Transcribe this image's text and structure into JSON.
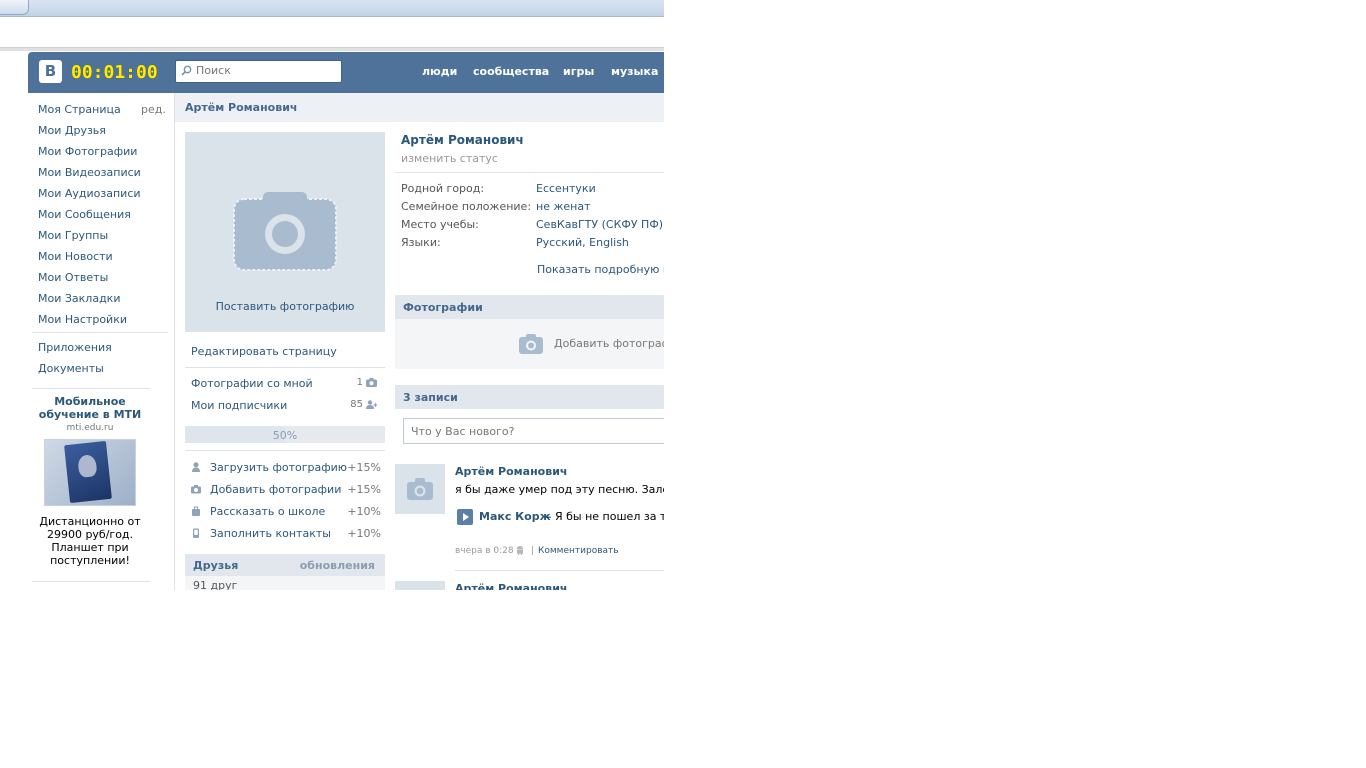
{
  "header": {
    "logo": "В",
    "timer": "00:01:00",
    "search_placeholder": "Поиск",
    "nav": [
      "люди",
      "сообщества",
      "игры",
      "музыка"
    ]
  },
  "sidebar": {
    "items": [
      "Моя Страница",
      "Мои Друзья",
      "Мои Фотографии",
      "Мои Видеозаписи",
      "Мои Аудиозаписи",
      "Мои Сообщения",
      "Мои Группы",
      "Мои Новости",
      "Мои Ответы",
      "Мои Закладки",
      "Мои Настройки"
    ],
    "edit_label": "ред.",
    "extra_items": [
      "Приложения",
      "Документы"
    ],
    "ad": {
      "title": "Мобильное обучение в МТИ",
      "url": "mti.edu.ru",
      "text": "Дистанционно от 29900 руб/год. Планшет при поступлении!"
    }
  },
  "page": {
    "title": "Артём Романович",
    "avatar_label": "Поставить фотографию",
    "edit_page": "Редактировать страницу",
    "counters": [
      {
        "label": "Фотографии со мной",
        "count": "1",
        "icon": "camera-icon"
      },
      {
        "label": "Мои подписчики",
        "count": "85",
        "icon": "followers-icon"
      }
    ],
    "progress": {
      "value": 50,
      "label": "50%"
    },
    "tasks": [
      {
        "label": "Загрузить фотографию",
        "value": "+15%",
        "icon": "user-icon"
      },
      {
        "label": "Добавить фотографии",
        "value": "+15%",
        "icon": "camera-icon"
      },
      {
        "label": "Рассказать о школе",
        "value": "+10%",
        "icon": "briefcase-icon"
      },
      {
        "label": "Заполнить контакты",
        "value": "+10%",
        "icon": "phone-icon"
      }
    ],
    "friends": {
      "title": "Друзья",
      "updates": "обновления",
      "count": "91 друг"
    }
  },
  "profile": {
    "name": "Артём Романович",
    "status": "изменить статус",
    "info": [
      {
        "key": "Родной город:",
        "value": "Ессентуки"
      },
      {
        "key": "Семейное положение:",
        "value": "не женат"
      },
      {
        "key": "Место учебы:",
        "value": "СевКавГТУ (СКФУ ПФ)"
      },
      {
        "key": "Языки:",
        "value": "Русский, English"
      }
    ],
    "more": "Показать подробную инф",
    "photos": {
      "title": "Фотографии",
      "add": "Добавить фотографии"
    },
    "wall": {
      "title": "3 записи",
      "input_placeholder": "Что у Вас нового?",
      "posts": [
        {
          "author": "Артём Романович",
          "text": "я бы даже умер под эту песню. Залетела и",
          "audio_artist": "Макс Корж",
          "audio_title": "– Я бы не пошел за тоб",
          "time": "вчера в 0:28",
          "comment": "Комментировать"
        },
        {
          "author": "Артём Романович"
        }
      ]
    }
  }
}
